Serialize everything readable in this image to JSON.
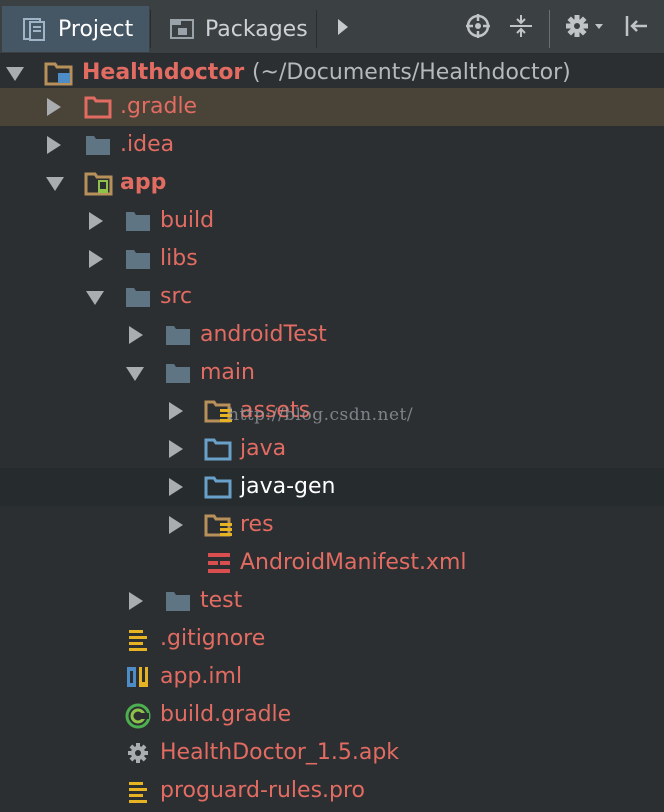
{
  "toolbar": {
    "tabs": [
      {
        "label": "Project",
        "active": true
      },
      {
        "label": "Packages",
        "active": false
      }
    ]
  },
  "tree": {
    "root": {
      "label": "Healthdoctor",
      "path": "(~/Documents/Healthdoctor)"
    },
    "items": [
      {
        "label": ".gradle"
      },
      {
        "label": ".idea"
      },
      {
        "label": "app"
      },
      {
        "label": "build"
      },
      {
        "label": "libs"
      },
      {
        "label": "src"
      },
      {
        "label": "androidTest"
      },
      {
        "label": "main"
      },
      {
        "label": "assets"
      },
      {
        "label": "java"
      },
      {
        "label": "java-gen"
      },
      {
        "label": "res"
      },
      {
        "label": "AndroidManifest.xml"
      },
      {
        "label": "test"
      },
      {
        "label": ".gitignore"
      },
      {
        "label": "app.iml"
      },
      {
        "label": "build.gradle"
      },
      {
        "label": "HealthDoctor_1.5.apk"
      },
      {
        "label": "proguard-rules.pro"
      }
    ]
  },
  "watermark": "http://blog.csdn.net/",
  "colors": {
    "background": "#2b2f31",
    "toolbar": "#3b4043",
    "active_tab": "#455665",
    "label": "#e26b62",
    "selected_row": "#4a4337",
    "folder": "#5f7583",
    "source_folder": "#6aa1cb",
    "resource_folder": "#b8915a"
  }
}
